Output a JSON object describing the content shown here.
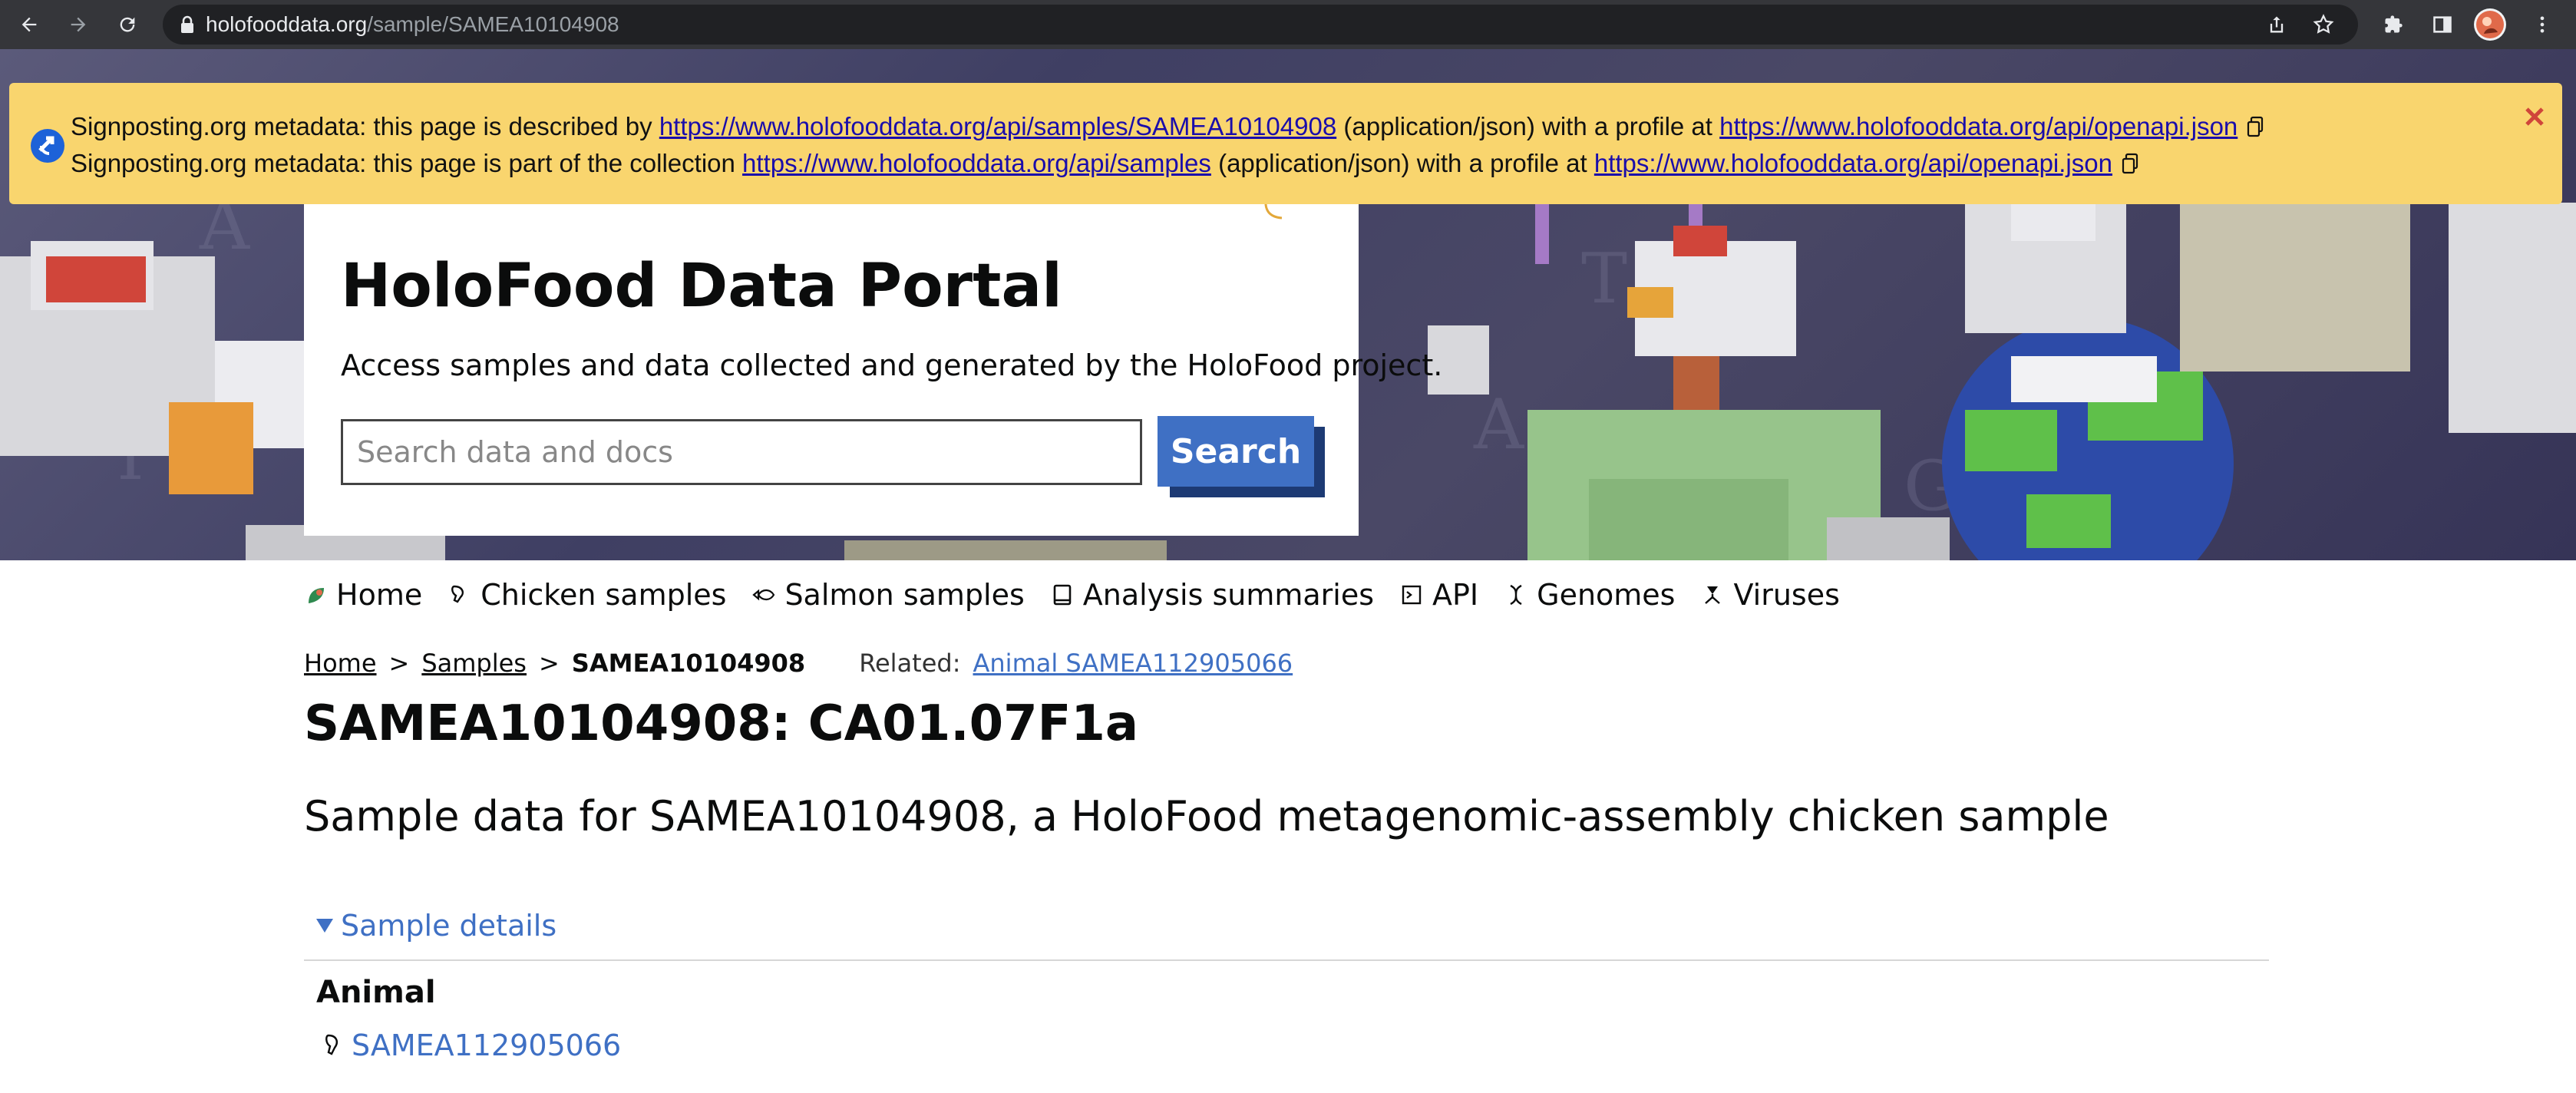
{
  "browser": {
    "url_host": "holofooddata.org",
    "url_path": "/sample/SAMEA10104908"
  },
  "banner": {
    "line1_prefix": "Signposting.org metadata: this page is described by",
    "line1_link": "https://www.holofooddata.org/api/samples/SAMEA10104908",
    "line1_mid": "(application/json) with a profile at",
    "line1_profile": "https://www.holofooddata.org/api/openapi.json",
    "line2_prefix": "Signposting.org metadata: this page is part of the collection",
    "line2_link": "https://www.holofooddata.org/api/samples",
    "line2_mid": "(application/json) with a profile at",
    "line2_profile": "https://www.holofooddata.org/api/openapi.json"
  },
  "hero": {
    "title": "HoloFood Data Portal",
    "subtitle": "Access samples and data collected and generated by the HoloFood project.",
    "search_placeholder": "Search data and docs",
    "search_button": "Search"
  },
  "nav": {
    "items": [
      {
        "label": "Home",
        "icon": "leaf-icon"
      },
      {
        "label": "Chicken samples",
        "icon": "chicken-leg-icon"
      },
      {
        "label": "Salmon samples",
        "icon": "fish-icon"
      },
      {
        "label": "Analysis summaries",
        "icon": "book-icon"
      },
      {
        "label": "API",
        "icon": "terminal-icon"
      },
      {
        "label": "Genomes",
        "icon": "dna-icon"
      },
      {
        "label": "Viruses",
        "icon": "virus-icon"
      }
    ]
  },
  "breadcrumb": {
    "home": "Home",
    "samples": "Samples",
    "sep": ">",
    "current": "SAMEA10104908",
    "related_label": "Related:",
    "related_link": "Animal SAMEA112905066"
  },
  "main": {
    "title": "SAMEA10104908: CA01.07F1a",
    "subtitle": "Sample data for SAMEA10104908, a HoloFood metagenomic-assembly chicken sample",
    "details_summary": "Sample details",
    "animal_heading": "Animal",
    "animal_link": "SAMEA112905066"
  },
  "colors": {
    "accent_blue": "#3f70c4",
    "banner_yellow": "#f9d56e",
    "chrome_dark": "#35363a"
  }
}
